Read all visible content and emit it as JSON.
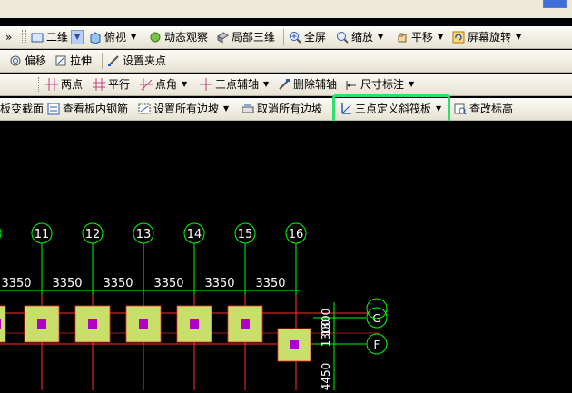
{
  "toolbar1": {
    "expand": "»",
    "view2d": "二维",
    "top_view": "俯视",
    "dynamic_observe": "动态观察",
    "local_3d": "局部三维",
    "fullscreen": "全屏",
    "zoom": "缩放",
    "pan": "平移",
    "rotate_screen": "屏幕旋转"
  },
  "toolbar2": {
    "offset": "偏移",
    "stretch": "拉伸",
    "set_grip": "设置夹点"
  },
  "toolbar3": {
    "two_point": "两点",
    "parallel": "平行",
    "point_angle": "点角",
    "three_point_axis": "三点辅轴",
    "delete_axis": "删除辅轴",
    "dimension": "尺寸标注"
  },
  "toolbar4": {
    "slab_section": "板变截面",
    "view_rebar": "查看板内钢筋",
    "set_all_slopes": "设置所有边坡",
    "cancel_all_slopes": "取消所有边坡",
    "three_point_slab": "三点定义斜筏板",
    "check_elevation": "查改标高"
  },
  "drawing": {
    "axes": [
      {
        "label": "11"
      },
      {
        "label": "12"
      },
      {
        "label": "13"
      },
      {
        "label": "14"
      },
      {
        "label": "15"
      },
      {
        "label": "16"
      }
    ],
    "spans": [
      "3350",
      "3350",
      "3350",
      "3350",
      "3350",
      "3350"
    ],
    "row_axes": [
      "G",
      "F"
    ],
    "vertical_dims": [
      "1300",
      "1300",
      "4450"
    ]
  },
  "colors": {
    "highlight": "#2ee06a",
    "axis": "#00ff00",
    "grid_red": "#ff3030",
    "pad": "#c8e06a",
    "column": "#b000c8"
  }
}
